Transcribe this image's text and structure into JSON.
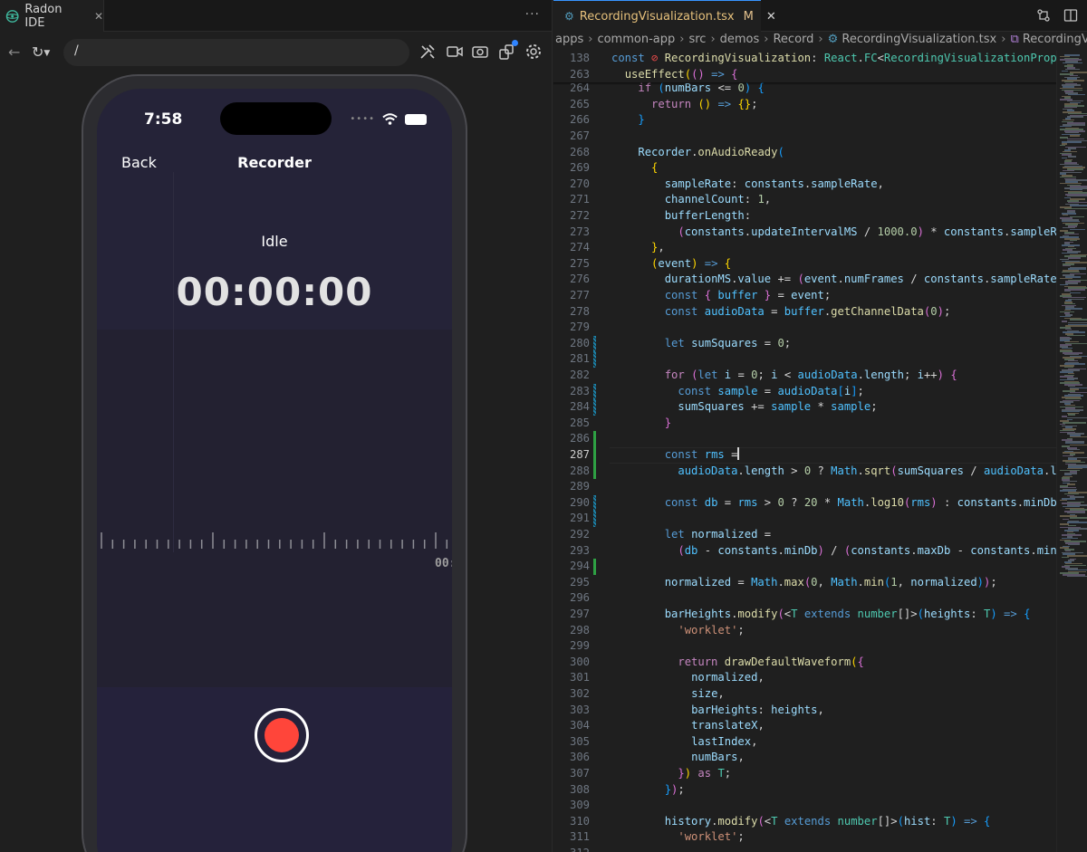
{
  "left": {
    "tab_label": "Radon IDE",
    "tab_close": "✕",
    "more": "···",
    "url_value": "/",
    "phone": {
      "time": "7:58",
      "back": "Back",
      "title": "Recorder",
      "status": "Idle",
      "timer": "00:00:00",
      "timeline_label": "00:"
    }
  },
  "right": {
    "tab_file": "RecordingVisualization.tsx",
    "tab_modified": "M",
    "tab_close": "✕",
    "breadcrumbs": [
      "apps",
      "common-app",
      "src",
      "demos",
      "Record",
      "RecordingVisualization.tsx",
      "RecordingVisualization"
    ],
    "current_line": "287",
    "lines": [
      {
        "n": "138",
        "h": "<span class=\"kw\">const</span> <span style=\"color:#f14c4c\">⊘</span> <span class=\"fn\">RecordingVisualization</span>: <span class=\"typ\">React</span>.<span class=\"typ\">FC</span>&lt;<span class=\"typ\">RecordingVisualizationProps</span>&gt;"
      },
      {
        "n": "263",
        "h": "  <span class=\"fn\">useEffect</span><span class=\"p1\">(</span><span class=\"p2\">()</span> <span class=\"kw\">=&gt;</span> <span class=\"p2\">{</span>"
      },
      {
        "n": "264",
        "h": "    <span class=\"ctl\">if</span> <span class=\"p3\">(</span><span class=\"var\">numBars</span> &lt;= <span class=\"num\">0</span><span class=\"p3\">)</span> <span class=\"p3\">{</span>"
      },
      {
        "n": "265",
        "h": "      <span class=\"ctl\">return</span> <span class=\"p1\">()</span> <span class=\"kw\">=&gt;</span> <span class=\"p1\">{}</span>;"
      },
      {
        "n": "266",
        "h": "    <span class=\"p3\">}</span>"
      },
      {
        "n": "267",
        "h": ""
      },
      {
        "n": "268",
        "h": "    <span class=\"var\">Recorder</span>.<span class=\"fn\">onAudioReady</span><span class=\"p3\">(</span>"
      },
      {
        "n": "269",
        "h": "      <span class=\"p1\">{</span>"
      },
      {
        "n": "270",
        "h": "        <span class=\"var\">sampleRate</span>: <span class=\"var\">constants</span>.<span class=\"var\">sampleRate</span>,"
      },
      {
        "n": "271",
        "h": "        <span class=\"var\">channelCount</span>: <span class=\"num\">1</span>,"
      },
      {
        "n": "272",
        "h": "        <span class=\"var\">bufferLength</span>:"
      },
      {
        "n": "273",
        "h": "          <span class=\"p2\">(</span><span class=\"var\">constants</span>.<span class=\"var\">updateIntervalMS</span> / <span class=\"num\">1000.0</span><span class=\"p2\">)</span> * <span class=\"var\">constants</span>.<span class=\"var\">sampleRate</span>"
      },
      {
        "n": "274",
        "h": "      <span class=\"p1\">}</span>,"
      },
      {
        "n": "275",
        "h": "      <span class=\"p1\">(</span><span class=\"var\">event</span><span class=\"p1\">)</span> <span class=\"kw\">=&gt;</span> <span class=\"p1\">{</span>"
      },
      {
        "n": "276",
        "h": "        <span class=\"var\">durationMS</span>.<span class=\"var\">value</span> += <span class=\"p2\">(</span><span class=\"var\">event</span>.<span class=\"var\">numFrames</span> / <span class=\"var\">constants</span>.<span class=\"var\">sampleRate</span><span class=\"p2\">)</span> *"
      },
      {
        "n": "277",
        "h": "        <span class=\"kw\">const</span> <span class=\"p2\">{</span> <span class=\"cst\">buffer</span> <span class=\"p2\">}</span> = <span class=\"var\">event</span>;"
      },
      {
        "n": "278",
        "h": "        <span class=\"kw\">const</span> <span class=\"cst\">audioData</span> = <span class=\"cst\">buffer</span>.<span class=\"fn\">getChannelData</span><span class=\"p2\">(</span><span class=\"num\">0</span><span class=\"p2\">)</span>;"
      },
      {
        "n": "279",
        "h": ""
      },
      {
        "n": "280",
        "h": "        <span class=\"kw\">let</span> <span class=\"var\">sumSquares</span> = <span class=\"num\">0</span>;"
      },
      {
        "n": "281",
        "h": ""
      },
      {
        "n": "282",
        "h": "        <span class=\"ctl\">for</span> <span class=\"p2\">(</span><span class=\"kw\">let</span> <span class=\"var\">i</span> = <span class=\"num\">0</span>; <span class=\"var\">i</span> &lt; <span class=\"cst\">audioData</span>.<span class=\"var\">length</span>; <span class=\"var\">i</span>++<span class=\"p2\">)</span> <span class=\"p2\">{</span>"
      },
      {
        "n": "283",
        "h": "          <span class=\"kw\">const</span> <span class=\"cst\">sample</span> = <span class=\"cst\">audioData</span><span class=\"p3\">[</span><span class=\"var\">i</span><span class=\"p3\">]</span>;"
      },
      {
        "n": "284",
        "h": "          <span class=\"var\">sumSquares</span> += <span class=\"cst\">sample</span> * <span class=\"cst\">sample</span>;"
      },
      {
        "n": "285",
        "h": "        <span class=\"p2\">}</span>"
      },
      {
        "n": "286",
        "h": ""
      },
      {
        "n": "287",
        "h": "        <span class=\"kw\">const</span> <span class=\"cst\">rms</span> =<span class=\"caret\"></span>"
      },
      {
        "n": "288",
        "h": "          <span class=\"cst\">audioData</span>.<span class=\"var\">length</span> &gt; <span class=\"num\">0</span> ? <span class=\"cst\">Math</span>.<span class=\"fn\">sqrt</span><span class=\"p2\">(</span><span class=\"var\">sumSquares</span> / <span class=\"cst\">audioData</span>.<span class=\"var\">leng</span>"
      },
      {
        "n": "289",
        "h": ""
      },
      {
        "n": "290",
        "h": "        <span class=\"kw\">const</span> <span class=\"cst\">db</span> = <span class=\"cst\">rms</span> &gt; <span class=\"num\">0</span> ? <span class=\"num\">20</span> * <span class=\"cst\">Math</span>.<span class=\"fn\">log10</span><span class=\"p2\">(</span><span class=\"cst\">rms</span><span class=\"p2\">)</span> : <span class=\"var\">constants</span>.<span class=\"var\">minDb</span>;"
      },
      {
        "n": "291",
        "h": ""
      },
      {
        "n": "292",
        "h": "        <span class=\"kw\">let</span> <span class=\"var\">normalized</span> ="
      },
      {
        "n": "293",
        "h": "          <span class=\"p2\">(</span><span class=\"cst\">db</span> - <span class=\"var\">constants</span>.<span class=\"var\">minDb</span><span class=\"p2\">)</span> / <span class=\"p2\">(</span><span class=\"var\">constants</span>.<span class=\"var\">maxDb</span> - <span class=\"var\">constants</span>.<span class=\"var\">minDb</span><span class=\"p2\">)</span>"
      },
      {
        "n": "294",
        "h": ""
      },
      {
        "n": "295",
        "h": "        <span class=\"var\">normalized</span> = <span class=\"cst\">Math</span>.<span class=\"fn\">max</span><span class=\"p2\">(</span><span class=\"num\">0</span>, <span class=\"cst\">Math</span>.<span class=\"fn\">min</span><span class=\"p3\">(</span><span class=\"num\">1</span>, <span class=\"var\">normalized</span><span class=\"p3\">)</span><span class=\"p2\">)</span>;"
      },
      {
        "n": "296",
        "h": ""
      },
      {
        "n": "297",
        "h": "        <span class=\"var\">barHeights</span>.<span class=\"fn\">modify</span><span class=\"p2\">(</span>&lt;<span class=\"typ\">T</span> <span class=\"kw\">extends</span> <span class=\"typ\">number</span>[]&gt;<span class=\"p3\">(</span><span class=\"var\">heights</span>: <span class=\"typ\">T</span><span class=\"p3\">)</span> <span class=\"kw\">=&gt;</span> <span class=\"p3\">{</span>"
      },
      {
        "n": "298",
        "h": "          <span class=\"str\">'worklet'</span>;"
      },
      {
        "n": "299",
        "h": ""
      },
      {
        "n": "300",
        "h": "          <span class=\"ctl\">return</span> <span class=\"fn\">drawDefaultWaveform</span><span class=\"p1\">(</span><span class=\"p2\">{</span>"
      },
      {
        "n": "301",
        "h": "            <span class=\"var\">normalized</span>,"
      },
      {
        "n": "302",
        "h": "            <span class=\"var\">size</span>,"
      },
      {
        "n": "303",
        "h": "            <span class=\"var\">barHeights</span>: <span class=\"var\">heights</span>,"
      },
      {
        "n": "304",
        "h": "            <span class=\"var\">translateX</span>,"
      },
      {
        "n": "305",
        "h": "            <span class=\"var\">lastIndex</span>,"
      },
      {
        "n": "306",
        "h": "            <span class=\"var\">numBars</span>,"
      },
      {
        "n": "307",
        "h": "          <span class=\"p2\">}</span><span class=\"p1\">)</span> <span class=\"ctl\">as</span> <span class=\"typ\">T</span>;"
      },
      {
        "n": "308",
        "h": "        <span class=\"p3\">}</span><span class=\"p2\">)</span>;"
      },
      {
        "n": "309",
        "h": ""
      },
      {
        "n": "310",
        "h": "        <span class=\"var\">history</span>.<span class=\"fn\">modify</span><span class=\"p2\">(</span>&lt;<span class=\"typ\">T</span> <span class=\"kw\">extends</span> <span class=\"typ\">number</span>[]&gt;<span class=\"p3\">(</span><span class=\"var\">hist</span>: <span class=\"typ\">T</span><span class=\"p3\">)</span> <span class=\"kw\">=&gt;</span> <span class=\"p3\">{</span>"
      },
      {
        "n": "311",
        "h": "          <span class=\"str\">'worklet'</span>;"
      },
      {
        "n": "312",
        "h": ""
      }
    ]
  },
  "colors": {
    "record_red": "#ff453a",
    "accent_blue": "#3794ff",
    "git_added": "#2ea043",
    "git_modified": "#1b81a8"
  }
}
